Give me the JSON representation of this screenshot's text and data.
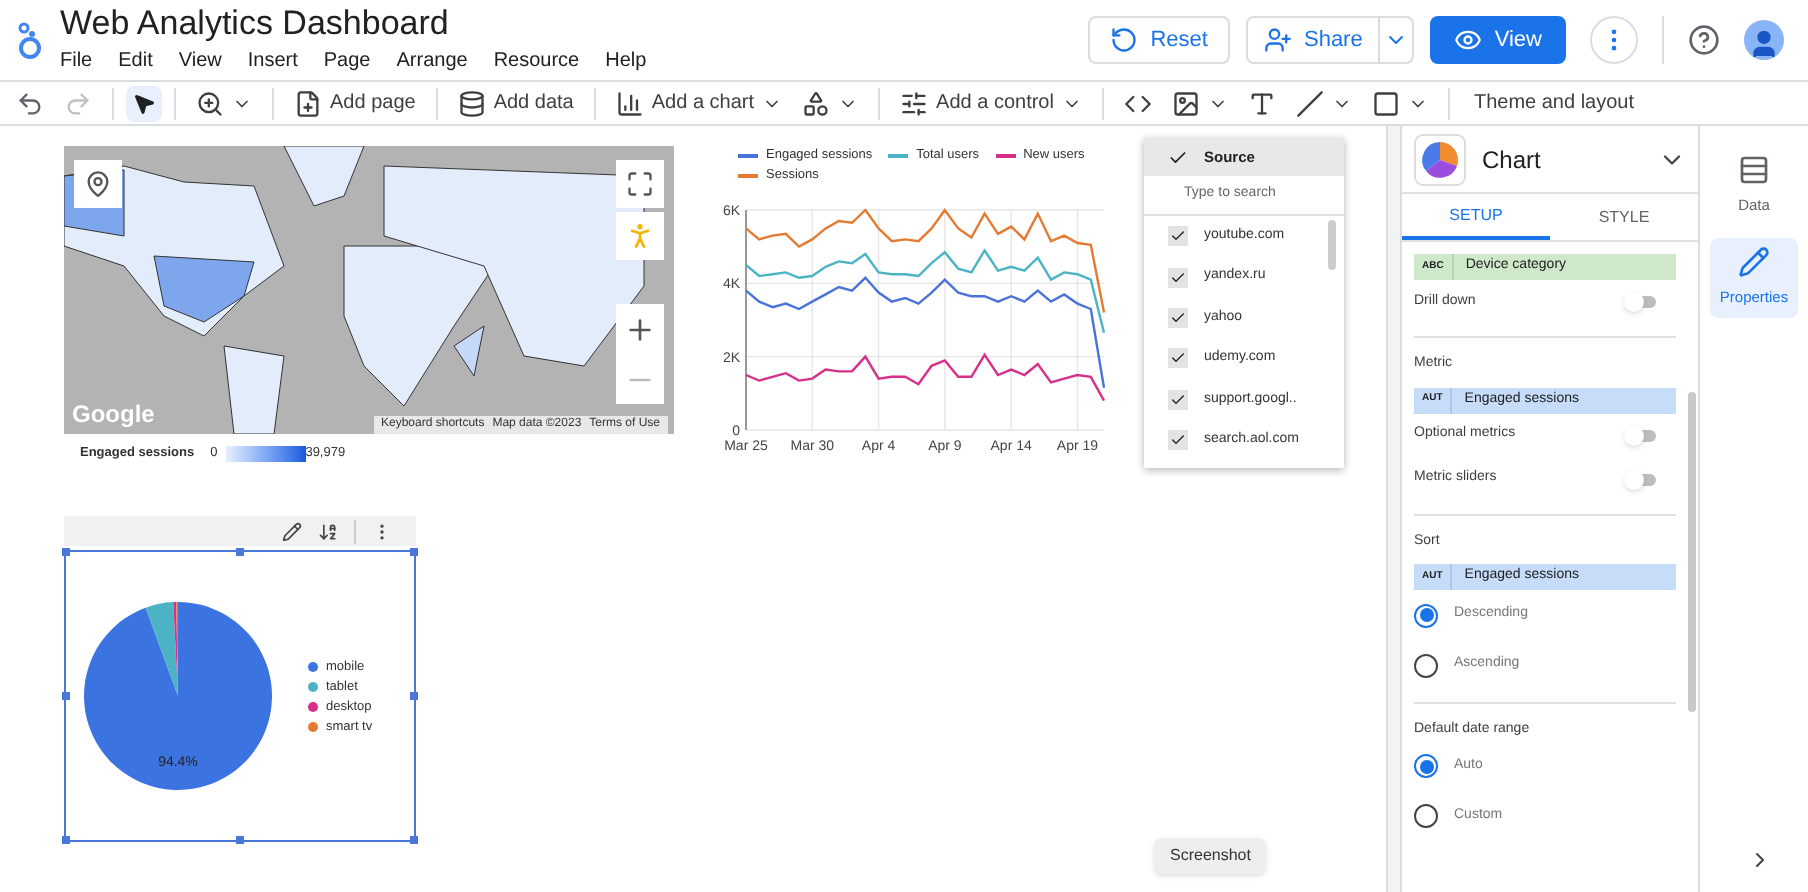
{
  "app": {
    "title": "Web Analytics Dashboard",
    "menus": [
      "File",
      "Edit",
      "View",
      "Insert",
      "Page",
      "Arrange",
      "Resource",
      "Help"
    ]
  },
  "header_buttons": {
    "reset": "Reset",
    "share": "Share",
    "view": "View"
  },
  "toolbar": {
    "select_tool": {
      "selected": true
    },
    "add_page": "Add page",
    "add_data": "Add data",
    "add_chart": "Add a chart",
    "add_control": "Add a control",
    "theme": "Theme and layout"
  },
  "map": {
    "logo": "Google",
    "attribution": [
      "Keyboard shortcuts",
      "Map data ©2023",
      "Terms of Use"
    ],
    "legend": {
      "label": "Engaged sessions",
      "min": "0",
      "max": "39,979"
    }
  },
  "line_chart": {
    "chart_data": {
      "type": "line",
      "categories": [
        "Mar 25",
        null,
        null,
        null,
        null,
        "Mar 30",
        null,
        null,
        null,
        null,
        "Apr 4",
        null,
        null,
        null,
        null,
        "Apr 9",
        null,
        null,
        null,
        null,
        "Apr 14",
        null,
        null,
        null,
        null,
        "Apr 19",
        null,
        null
      ],
      "grid": true,
      "yticks": [
        {
          "value": 0,
          "label": "0"
        },
        {
          "value": 2000,
          "label": "2K"
        },
        {
          "value": 4000,
          "label": "4K"
        },
        {
          "value": 6000,
          "label": "6K"
        }
      ],
      "ylim": [
        0,
        6000
      ],
      "series": [
        {
          "name": "Engaged sessions",
          "color": "#4a73d8",
          "values": [
            3800,
            3500,
            3350,
            3450,
            3300,
            3500,
            3700,
            3900,
            3800,
            4150,
            3750,
            3500,
            3600,
            3450,
            3750,
            4100,
            3750,
            3650,
            3650,
            3500,
            3650,
            3500,
            3800,
            3500,
            3700,
            3450,
            3300,
            1150
          ]
        },
        {
          "name": "Total users",
          "color": "#4bb3c4",
          "values": [
            4500,
            4200,
            4250,
            4300,
            4150,
            4200,
            4450,
            4600,
            4550,
            4800,
            4300,
            4250,
            4250,
            4200,
            4550,
            4850,
            4400,
            4300,
            4900,
            4350,
            4450,
            4350,
            4700,
            4100,
            4300,
            4250,
            4100,
            2650
          ]
        },
        {
          "name": "New users",
          "color": "#d6318a",
          "values": [
            1500,
            1350,
            1450,
            1550,
            1350,
            1400,
            1650,
            1600,
            1600,
            2000,
            1400,
            1450,
            1450,
            1250,
            1750,
            1900,
            1450,
            1450,
            2050,
            1500,
            1650,
            1500,
            1800,
            1300,
            1400,
            1500,
            1450,
            800
          ]
        },
        {
          "name": "Sessions",
          "color": "#e57a33",
          "values": [
            5500,
            5200,
            5300,
            5350,
            5000,
            5200,
            5500,
            5700,
            5650,
            6000,
            5500,
            5150,
            5200,
            5150,
            5500,
            6000,
            5500,
            5250,
            5900,
            5350,
            5550,
            5200,
            5900,
            5150,
            5300,
            5100,
            5050,
            3200
          ]
        }
      ]
    }
  },
  "filter": {
    "title": "Source",
    "checked": true,
    "placeholder": "Type to search",
    "items": [
      {
        "label": "youtube.com",
        "checked": true
      },
      {
        "label": "yandex.ru",
        "checked": true
      },
      {
        "label": "yahoo",
        "checked": true
      },
      {
        "label": "udemy.com",
        "checked": true
      },
      {
        "label": "support.googl..",
        "checked": true
      },
      {
        "label": "search.aol.com",
        "checked": true
      }
    ]
  },
  "pie_chart": {
    "selected": true,
    "chart_data": {
      "type": "pie",
      "categories": [
        "mobile",
        "tablet",
        "desktop",
        "smart tv"
      ],
      "values": [
        94.4,
        4.8,
        0.5,
        0.3
      ],
      "value_labels": [
        "94.4%",
        null,
        null,
        null
      ]
    },
    "legend": [
      {
        "color": "#3b74e0"
      },
      {
        "color": "#4bb3c4"
      },
      {
        "color": "#d6318a"
      },
      {
        "color": "#e57a33"
      }
    ]
  },
  "panel": {
    "title": "Chart",
    "tabs": [
      {
        "label": "SETUP",
        "selected": true
      },
      {
        "label": "STYLE",
        "selected": false
      }
    ],
    "sections": [
      {
        "rows": [
          {
            "kind": "dimension_chip",
            "type": "ABC",
            "label": "Device category"
          },
          {
            "kind": "toggle",
            "label": "Drill down",
            "on": false
          }
        ]
      },
      {
        "heading": "Metric",
        "rows": [
          {
            "kind": "metric_chip",
            "type": "AUT",
            "label": "Engaged sessions"
          },
          {
            "kind": "toggle",
            "label": "Optional metrics",
            "on": false
          },
          {
            "kind": "toggle",
            "label": "Metric sliders",
            "on": false
          }
        ]
      },
      {
        "heading": "Sort",
        "rows": [
          {
            "kind": "metric_chip",
            "type": "AUT",
            "label": "Engaged sessions"
          },
          {
            "kind": "radio",
            "label": "Descending",
            "selected": true
          },
          {
            "kind": "radio",
            "label": "Ascending",
            "selected": false
          }
        ]
      },
      {
        "heading": "Default date range",
        "rows": [
          {
            "kind": "radio",
            "label": "Auto",
            "selected": true
          },
          {
            "kind": "radio",
            "label": "Custom",
            "selected": false
          }
        ]
      }
    ]
  },
  "rail": [
    {
      "label": "Data",
      "selected": false
    },
    {
      "label": "Properties",
      "selected": true
    }
  ],
  "tooltip": "Screenshot"
}
